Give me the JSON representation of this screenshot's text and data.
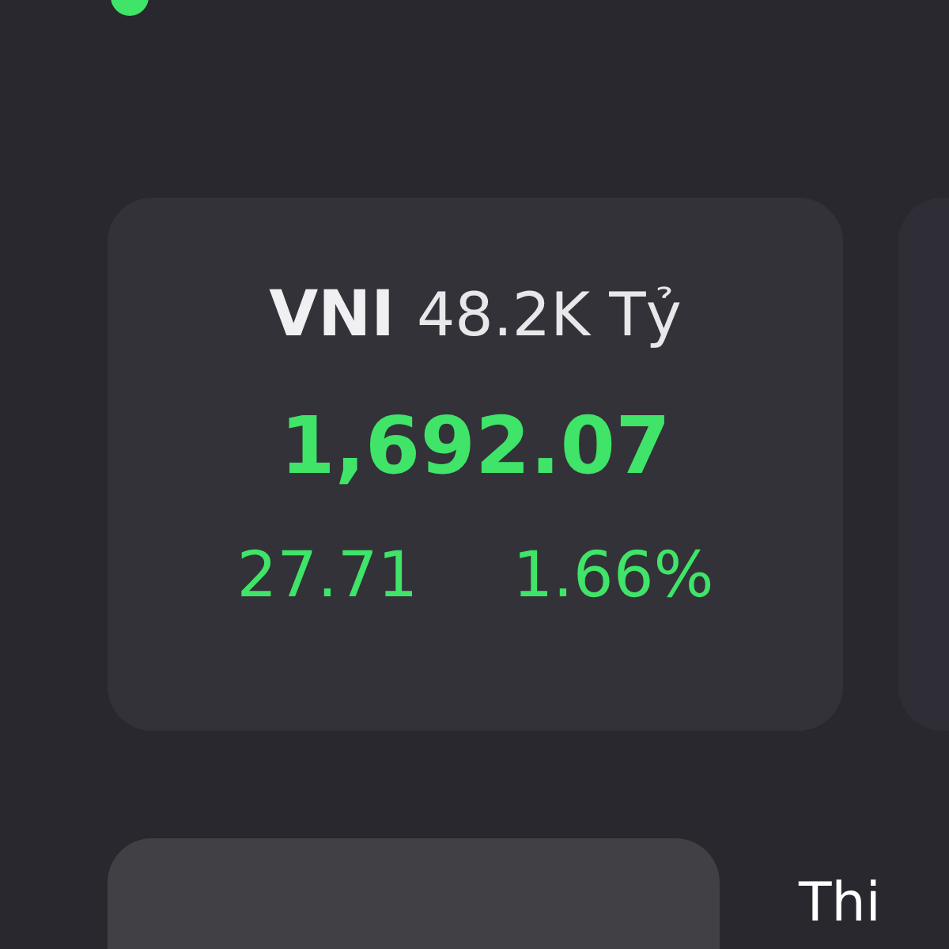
{
  "index_card": {
    "symbol": "VNI",
    "volume": "48.2K Tỷ",
    "price": "1,692.07",
    "change": "27.71",
    "change_percent": "1.66%"
  },
  "tabs": [
    {
      "selected": true
    },
    {
      "label": "Thi",
      "selected": false
    }
  ]
}
